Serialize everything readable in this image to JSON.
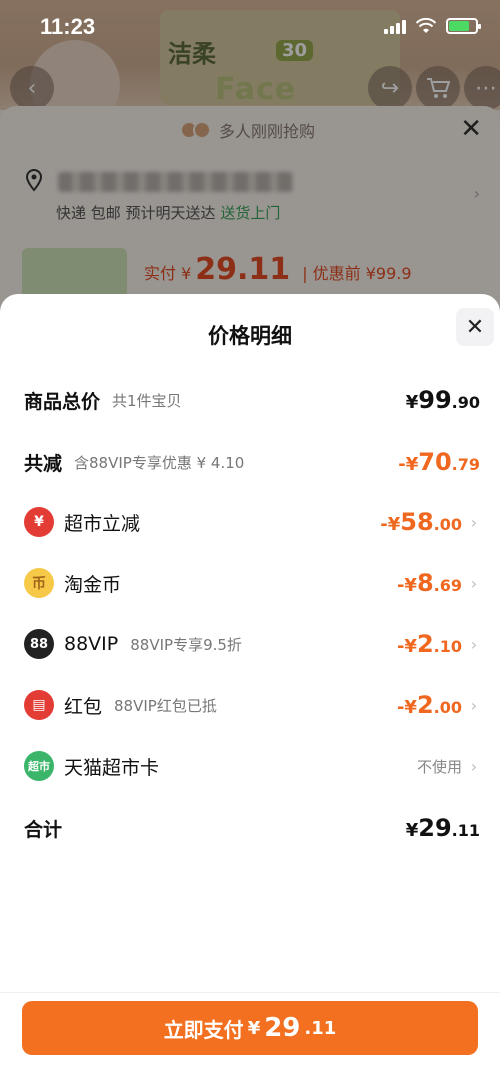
{
  "status": {
    "time": "11:23"
  },
  "background": {
    "brand": "洁柔",
    "badge": "30",
    "hero_text": "Face",
    "rush_text": "多人刚刚抢购",
    "shipping_prefix": "快递 包邮 预计明天送达",
    "shipping_highlight": "送货上门",
    "paid_label": "实付 ¥",
    "paid_amount": "29.11",
    "before_discount": "| 优惠前 ¥99.9"
  },
  "sheet": {
    "title": "价格明细",
    "rows": [
      {
        "label": "商品总价",
        "sub": "共1件宝贝",
        "cur": "¥",
        "int": "99",
        "dec": ".90"
      },
      {
        "label": "共减",
        "sub": "含88VIP专享优惠 ¥ 4.10",
        "cur": "-¥",
        "int": "70",
        "dec": ".79"
      },
      {
        "label": "超市立减",
        "sub": "",
        "cur": "-¥",
        "int": "58",
        "dec": ".00",
        "icon": "supermarket-discount-icon"
      },
      {
        "label": "淘金币",
        "sub": "",
        "cur": "-¥",
        "int": "8",
        "dec": ".69",
        "icon": "taojinbi-coin-icon"
      },
      {
        "label": "88VIP",
        "sub": "88VIP专享9.5折",
        "cur": "-¥",
        "int": "2",
        "dec": ".10",
        "icon": "vip88-icon"
      },
      {
        "label": "红包",
        "sub": "88VIP红包已抵",
        "cur": "-¥",
        "int": "2",
        "dec": ".00",
        "icon": "red-packet-icon"
      },
      {
        "label": "天猫超市卡",
        "sub": "",
        "value": "不使用",
        "icon": "tmall-card-icon"
      },
      {
        "label": "合计",
        "sub": "",
        "cur": "¥",
        "int": "29",
        "dec": ".11"
      }
    ],
    "icon_glyphs": {
      "supermarket": "¥",
      "coin": "币",
      "vip": "88",
      "packet": "▤",
      "card": "超市"
    }
  },
  "footer": {
    "pay_label": "立即支付",
    "cur": "¥",
    "int": "29",
    "dec": ".11"
  },
  "colors": {
    "accent": "#f2701f",
    "discount": "#f0681f"
  }
}
